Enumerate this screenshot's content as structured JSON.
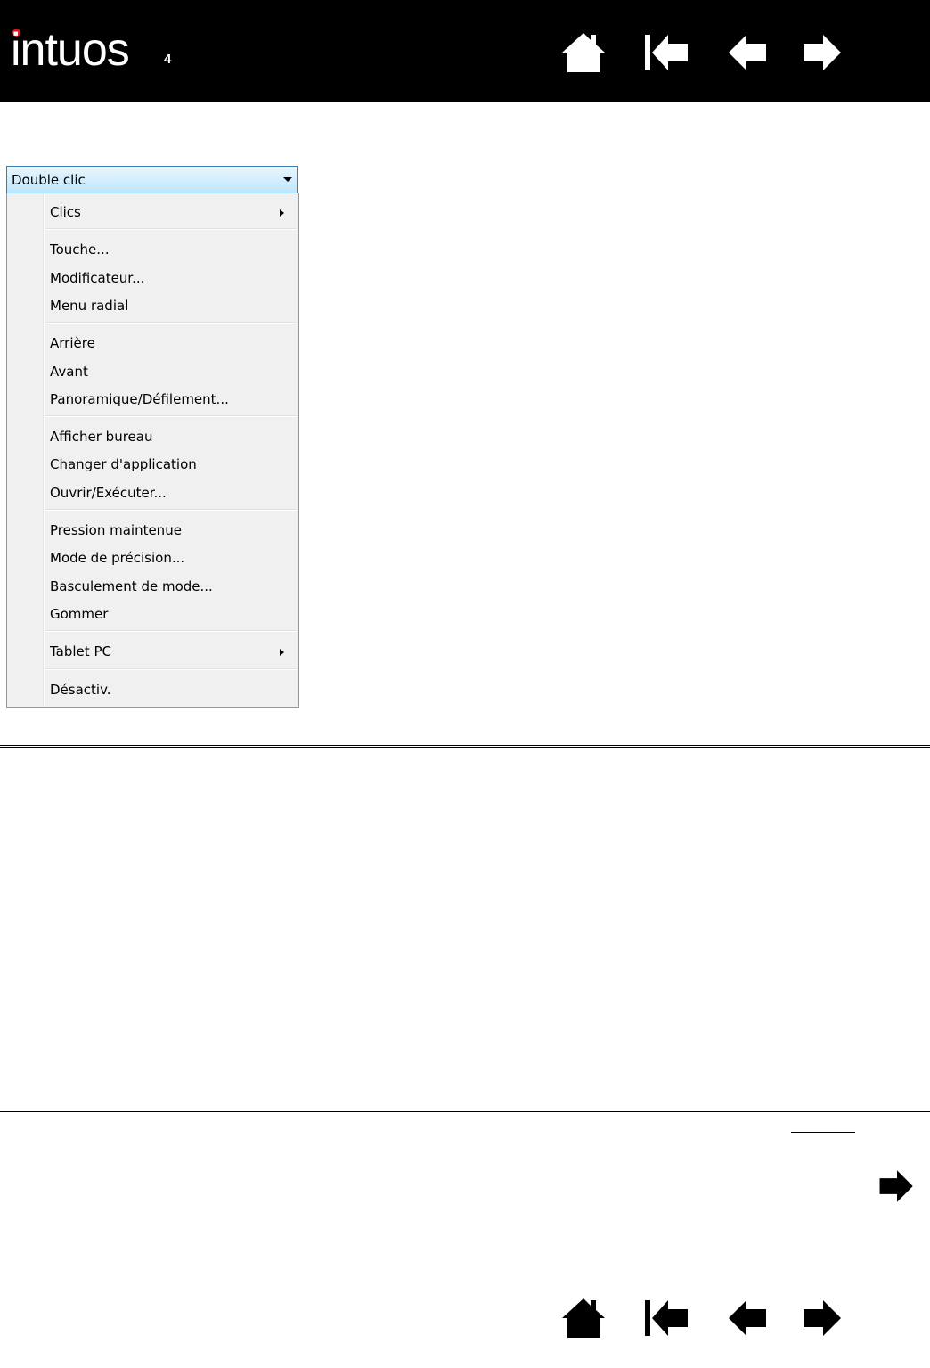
{
  "header": {
    "logo_text": "intuos",
    "logo_sub": "4",
    "logo_dot_color": "#d2161d",
    "nav": [
      {
        "icon": "home-icon",
        "label": "Home"
      },
      {
        "icon": "first-page-icon",
        "label": "First"
      },
      {
        "icon": "previous-page-icon",
        "label": "Previous"
      },
      {
        "icon": "next-page-icon",
        "label": "Next"
      }
    ]
  },
  "dropdown": {
    "selected": "Double clic",
    "icon": "chevron-down-icon"
  },
  "menu": {
    "groups": [
      [
        {
          "label": "Clics",
          "submenu": true
        }
      ],
      [
        {
          "label": "Touche..."
        },
        {
          "label": "Modificateur..."
        },
        {
          "label": "Menu radial"
        }
      ],
      [
        {
          "label": "Arrière"
        },
        {
          "label": "Avant"
        },
        {
          "label": "Panoramique/Défilement..."
        }
      ],
      [
        {
          "label": "Afficher bureau"
        },
        {
          "label": "Changer d'application"
        },
        {
          "label": "Ouvrir/Exécuter..."
        }
      ],
      [
        {
          "label": "Pression maintenue"
        },
        {
          "label": "Mode de précision..."
        },
        {
          "label": "Basculement de mode..."
        },
        {
          "label": "Gommer"
        }
      ],
      [
        {
          "label": "Tablet PC",
          "submenu": true
        }
      ],
      [
        {
          "label": "Désactiv."
        }
      ]
    ]
  },
  "footer": {
    "nav": [
      {
        "icon": "home-icon",
        "label": "Home"
      },
      {
        "icon": "first-page-icon",
        "label": "First"
      },
      {
        "icon": "previous-page-icon",
        "label": "Previous"
      },
      {
        "icon": "next-page-icon",
        "label": "Next"
      }
    ],
    "continue_icon": "next-page-icon"
  }
}
